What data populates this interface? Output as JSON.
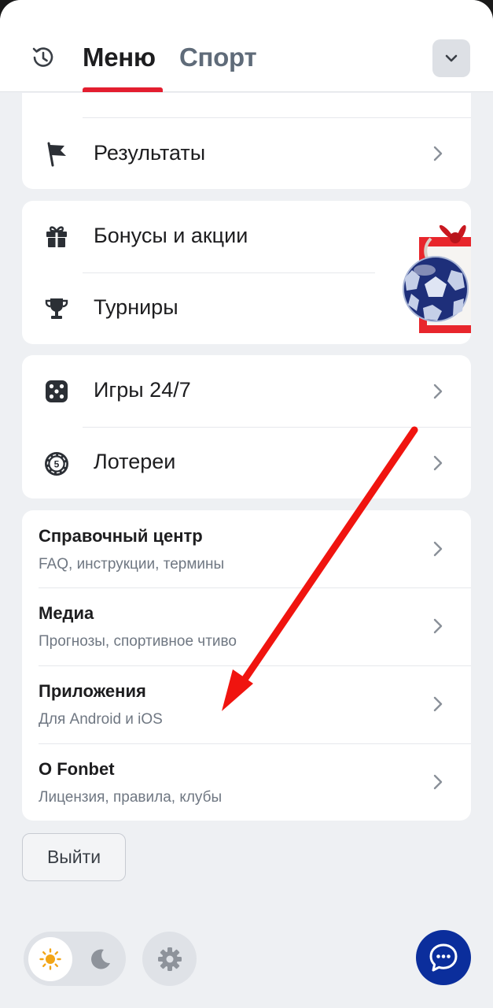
{
  "header": {
    "tabs": [
      {
        "label": "Меню",
        "active": true
      },
      {
        "label": "Спорт",
        "active": false
      }
    ],
    "accent_color": "#e31e2f"
  },
  "menu_card_1": {
    "items": [
      {
        "label": "Результаты",
        "icon": "flag-icon"
      }
    ]
  },
  "menu_card_2": {
    "items": [
      {
        "label": "Бонусы и акции",
        "icon": "gift-icon"
      },
      {
        "label": "Турниры",
        "icon": "trophy-icon"
      }
    ],
    "promo_image": "football-gift-image"
  },
  "menu_card_3": {
    "items": [
      {
        "label": "Игры 24/7",
        "icon": "dice-icon"
      },
      {
        "label": "Лотереи",
        "icon": "lottery-ball-icon"
      }
    ]
  },
  "info_card": {
    "items": [
      {
        "title": "Справочный центр",
        "subtitle": "FAQ, инструкции, термины"
      },
      {
        "title": "Медиа",
        "subtitle": "Прогнозы, спортивное чтиво"
      },
      {
        "title": "Приложения",
        "subtitle": "Для Android и iOS"
      },
      {
        "title": "О Fonbet",
        "subtitle": "Лицензия, правила, клубы"
      }
    ]
  },
  "logout": {
    "label": "Выйти"
  },
  "footer": {
    "theme": "light",
    "icons": [
      "sun-icon",
      "moon-icon",
      "gear-icon",
      "chat-icon"
    ],
    "chat_color": "#0b2e9c"
  },
  "annotation": {
    "arrow_color": "#f0140f"
  }
}
